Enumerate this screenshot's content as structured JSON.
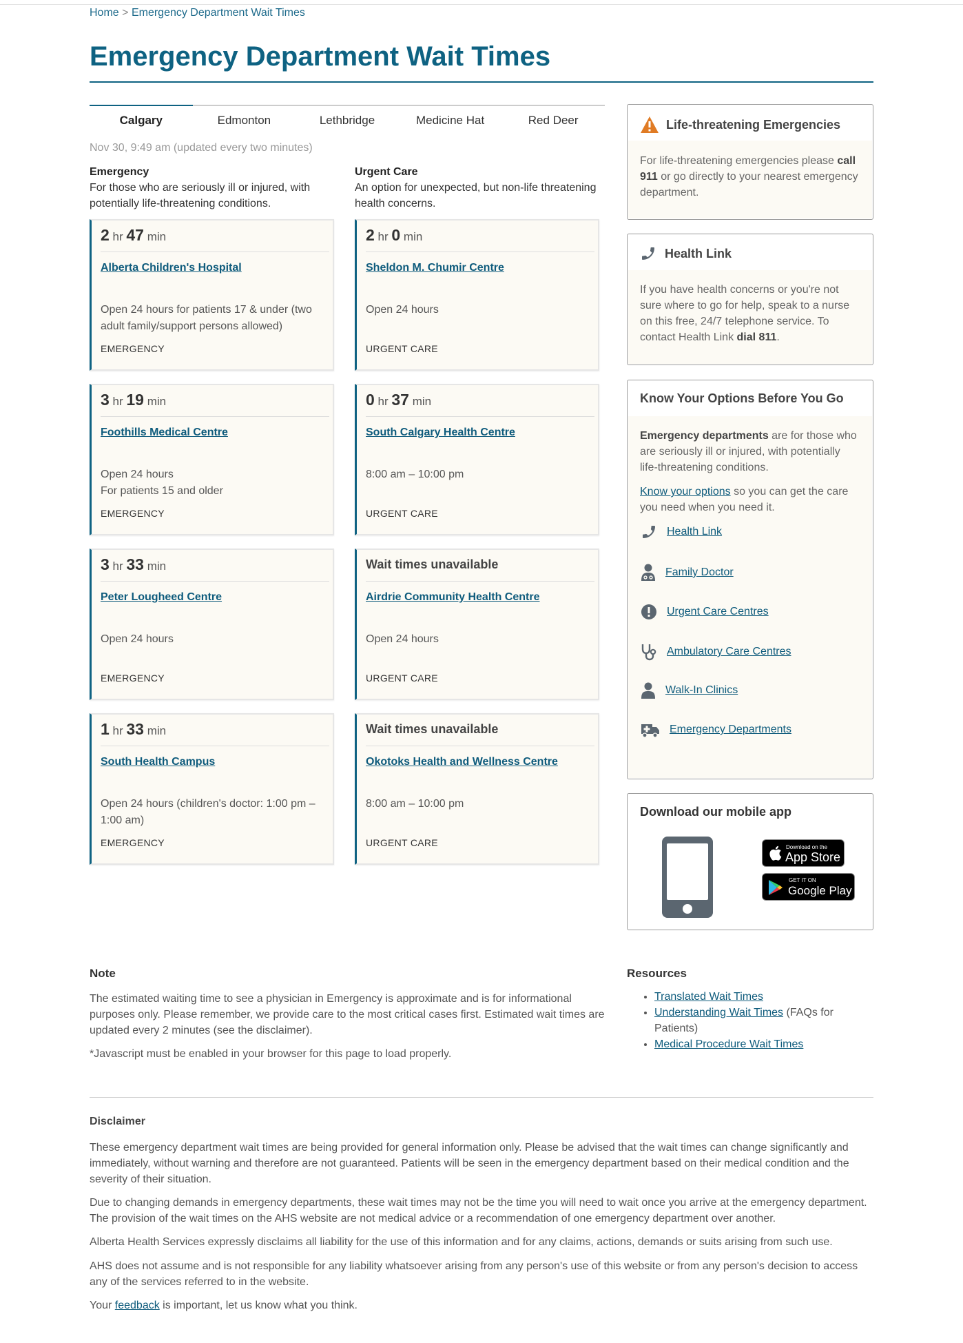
{
  "breadcrumb": {
    "home": "Home",
    "sep": ">",
    "current": "Emergency Department Wait Times"
  },
  "page_title": "Emergency Department Wait Times",
  "tabs": [
    "Calgary",
    "Edmonton",
    "Lethbridge",
    "Medicine Hat",
    "Red Deer"
  ],
  "active_tab": "Calgary",
  "updated": "Nov 30, 9:49 am (updated every two minutes)",
  "emergency_col": {
    "heading": "Emergency",
    "desc": "For those who are seriously ill or injured, with potentially life-threatening conditions."
  },
  "urgent_col": {
    "heading": "Urgent Care",
    "desc": "An option for unexpected, but non-life threatening health concerns."
  },
  "units": {
    "hr": "hr",
    "min": "min"
  },
  "cards": [
    {
      "hours_val": "2",
      "mins_val": "47",
      "name": "Alberta Children's Hospital",
      "hours": "Open 24 hours for patients 17 & under (two adult family/support persons allowed)",
      "type": "EMERGENCY"
    },
    {
      "hours_val": "2",
      "mins_val": "0",
      "name": "Sheldon M. Chumir Centre",
      "hours": "Open 24 hours",
      "type": "URGENT CARE"
    },
    {
      "hours_val": "3",
      "mins_val": "19",
      "name": "Foothills Medical Centre",
      "hours": "Open 24 hours",
      "hours2": "For patients 15 and older",
      "type": "EMERGENCY"
    },
    {
      "hours_val": "0",
      "mins_val": "37",
      "name": "South Calgary Health Centre",
      "hours": "8:00 am – 10:00 pm",
      "type": "URGENT CARE"
    },
    {
      "hours_val": "3",
      "mins_val": "33",
      "name": "Peter Lougheed Centre",
      "hours": "Open 24 hours",
      "type": "EMERGENCY"
    },
    {
      "unavailable": "Wait times unavailable",
      "name": "Airdrie Community Health Centre",
      "hours": "Open 24 hours",
      "type": "URGENT CARE"
    },
    {
      "hours_val": "1",
      "mins_val": "33",
      "name": "South Health Campus",
      "hours": "Open 24 hours (children's doctor: 1:00 pm – 1:00 am)",
      "type": "EMERGENCY"
    },
    {
      "unavailable": "Wait times unavailable",
      "name": "Okotoks Health and Wellness Centre",
      "hours": "8:00 am – 10:00 pm",
      "type": "URGENT CARE"
    }
  ],
  "sidebar": {
    "life": {
      "title": "Life-threatening Emergencies",
      "text_pre": "For life-threatening emergencies please ",
      "text_bold": "call 911",
      "text_post": " or go directly to your nearest emergency department."
    },
    "health_link": {
      "title": "Health Link",
      "text_pre": "If you have health concerns or you're not sure where to go for help, speak to a nurse on this free, 24/7 telephone service. To contact Health Link ",
      "text_bold": "dial 811",
      "text_post": "."
    },
    "options": {
      "title": "Know Your Options Before You Go",
      "p1_bold": "Emergency departments",
      "p1_rest": " are for those who are seriously ill or injured, with potentially life-threatening conditions.",
      "p2_link": "Know your options",
      "p2_rest": " so you can get the care you need when you need it.",
      "links": [
        {
          "label": "Health Link",
          "icon": "phone-icon"
        },
        {
          "label": "Family Doctor",
          "icon": "doctor-icon"
        },
        {
          "label": "Urgent Care Centres",
          "icon": "alert-circle-icon"
        },
        {
          "label": "Ambulatory Care Centres",
          "icon": "stethoscope-icon"
        },
        {
          "label": "Walk-In Clinics",
          "icon": "person-icon"
        },
        {
          "label": "Emergency Departments",
          "icon": "ambulance-icon"
        }
      ]
    },
    "app": {
      "title": "Download our mobile app",
      "appstore_small": "Download on the",
      "appstore_big": "App Store",
      "gplay_small": "GET IT ON",
      "gplay_big": "Google Play"
    }
  },
  "note": {
    "title": "Note",
    "p1": "The estimated waiting time to see a physician in Emergency is approximate and is for informational purposes only. Please remember, we provide care to the most critical cases first. Estimated wait times are updated every 2 minutes (see the disclaimer).",
    "p2": "*Javascript must be enabled in your browser for this page to load properly."
  },
  "resources": {
    "title": "Resources",
    "items": [
      {
        "link": "Translated Wait Times",
        "rest": ""
      },
      {
        "link": "Understanding Wait Times",
        "rest": " (FAQs for Patients)"
      },
      {
        "link": "Medical Procedure Wait Times",
        "rest": ""
      }
    ]
  },
  "disclaimer": {
    "title": "Disclaimer",
    "p1": "These emergency department wait times are being provided for general information only. Please be advised that the wait times can change significantly and immediately, without warning and therefore are not guaranteed. Patients will be seen in the emergency department based on their medical condition and the severity of their situation.",
    "p2": "Due to changing demands in emergency departments, these wait times may not be the time you will need to wait once you arrive at the emergency department. The provision of the wait times on the AHS website are not medical advice or a recommendation of one emergency department over another.",
    "p3": "Alberta Health Services expressly disclaims all liability for the use of this information and for any claims, actions, demands or suits arising from such use.",
    "p4": "AHS does not assume and is not responsible for any liability whatsoever arising from any person's use of this website or from any person's decision to access any of the services referred to in the website.",
    "p5_pre": "Your ",
    "p5_link": "feedback",
    "p5_post": " is important, let us know what you think."
  },
  "colors": {
    "brand": "#0e6282",
    "link": "#0e5b7c",
    "card_bg": "#fcfaf4",
    "warning": "#e07b24"
  }
}
